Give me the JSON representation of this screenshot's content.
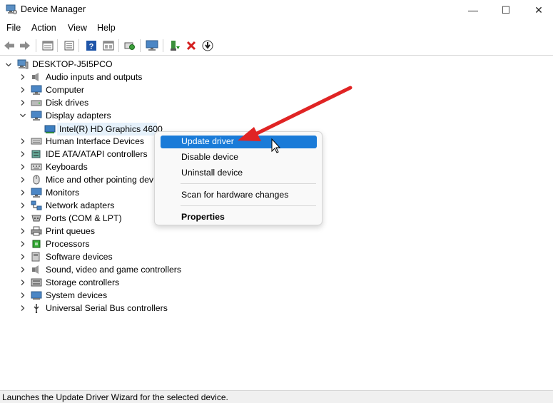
{
  "window": {
    "title": "Device Manager",
    "controls": {
      "minimize": "—",
      "maximize": "☐",
      "close": "✕"
    }
  },
  "menu": {
    "items": [
      "File",
      "Action",
      "View",
      "Help"
    ]
  },
  "toolbar": {
    "buttons": [
      "back-icon",
      "forward-icon",
      "properties-icon",
      "show-hidden-icon",
      "help-icon",
      "view-icon",
      "scan-hardware-icon",
      "monitor-icon",
      "update-driver-icon",
      "uninstall-icon",
      "download-icon"
    ]
  },
  "tree": {
    "root": "DESKTOP-J5I5PCO",
    "categories": [
      {
        "label": "Audio inputs and outputs",
        "icon": "speaker-icon",
        "expanded": false
      },
      {
        "label": "Computer",
        "icon": "computer-icon",
        "expanded": false
      },
      {
        "label": "Disk drives",
        "icon": "disk-icon",
        "expanded": false
      },
      {
        "label": "Display adapters",
        "icon": "display-adapter-icon",
        "expanded": true,
        "children": [
          {
            "label": "Intel(R) HD Graphics 4600",
            "icon": "display-adapter-icon",
            "selected": true
          }
        ]
      },
      {
        "label": "Human Interface Devices",
        "icon": "hid-icon",
        "expanded": false
      },
      {
        "label": "IDE ATA/ATAPI controllers",
        "icon": "ide-icon",
        "expanded": false
      },
      {
        "label": "Keyboards",
        "icon": "keyboard-icon",
        "expanded": false
      },
      {
        "label": "Mice and other pointing dev",
        "icon": "mouse-icon",
        "expanded": false
      },
      {
        "label": "Monitors",
        "icon": "monitor-icon",
        "expanded": false
      },
      {
        "label": "Network adapters",
        "icon": "network-icon",
        "expanded": false
      },
      {
        "label": "Ports (COM & LPT)",
        "icon": "port-icon",
        "expanded": false
      },
      {
        "label": "Print queues",
        "icon": "printer-icon",
        "expanded": false
      },
      {
        "label": "Processors",
        "icon": "cpu-icon",
        "expanded": false
      },
      {
        "label": "Software devices",
        "icon": "software-icon",
        "expanded": false
      },
      {
        "label": "Sound, video and game controllers",
        "icon": "sound-icon",
        "expanded": false
      },
      {
        "label": "Storage controllers",
        "icon": "storage-icon",
        "expanded": false
      },
      {
        "label": "System devices",
        "icon": "system-icon",
        "expanded": false
      },
      {
        "label": "Universal Serial Bus controllers",
        "icon": "usb-icon",
        "expanded": false
      }
    ]
  },
  "context_menu": {
    "items": [
      {
        "label": "Update driver",
        "highlighted": true
      },
      {
        "label": "Disable device"
      },
      {
        "label": "Uninstall device"
      },
      {
        "label": "Scan for hardware changes"
      },
      {
        "label": "Properties",
        "bold": true
      }
    ]
  },
  "status_bar": {
    "text": "Launches the Update Driver Wizard for the selected device."
  },
  "colors": {
    "selection": "#e5f1fb",
    "menu_highlight": "#1a7bd8",
    "annotation_arrow": "#e02424"
  }
}
